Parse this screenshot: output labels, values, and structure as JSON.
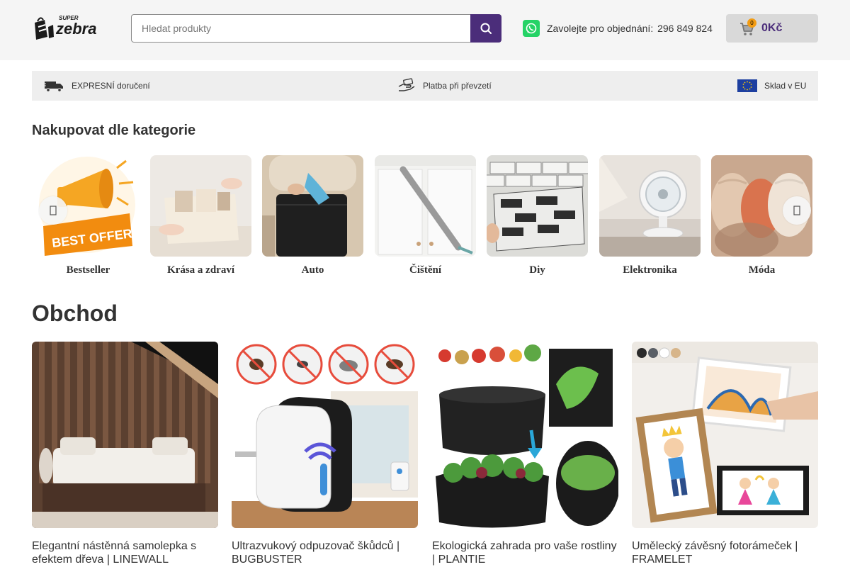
{
  "header": {
    "logo_top": "SUPER",
    "logo_main": "zebra",
    "search_placeholder": "Hledat produkty",
    "order_label": "Zavolejte pro objednání:",
    "order_phone": "296 849 824",
    "cart_count": "0",
    "cart_total": "0Kč",
    "colors": {
      "accent": "#4b2d7a",
      "whatsapp": "#25d366",
      "badge": "#f39c12"
    }
  },
  "infobar": {
    "items": [
      {
        "icon": "truck-icon",
        "label": "EXPRESNÍ doručení"
      },
      {
        "icon": "hand-money-icon",
        "label": "Platba při převzetí"
      },
      {
        "icon": "eu-flag-icon",
        "label": "Sklad v EU"
      }
    ]
  },
  "categories": {
    "title": "Nakupovat dle kategorie",
    "prev_icon": "chevron-left-icon",
    "next_icon": "chevron-right-icon",
    "items": [
      {
        "label": "Bestseller",
        "badge": "BEST OFFER"
      },
      {
        "label": "Krása a zdraví"
      },
      {
        "label": "Auto"
      },
      {
        "label": "Čištění"
      },
      {
        "label": "Diy"
      },
      {
        "label": "Elektronika"
      },
      {
        "label": "Móda"
      }
    ]
  },
  "shop": {
    "title": "Obchod",
    "products": [
      {
        "name": "Elegantní nástěnná samolepka s efektem dřeva | LINEWALL"
      },
      {
        "name": "Ultrazvukový odpuzovač škůdců | BUGBUSTER"
      },
      {
        "name": "Ekologická zahrada pro vaše rostliny | PLANTIE"
      },
      {
        "name": "Umělecký závěsný fotorámeček | FRAMELET"
      }
    ]
  }
}
